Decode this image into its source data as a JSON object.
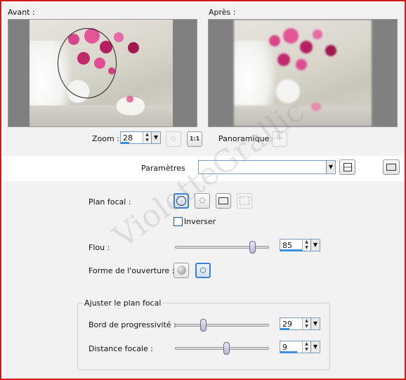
{
  "before_label": "Avant :",
  "after_label": "Après :",
  "zoom": {
    "label": "Zoom :",
    "value": "28",
    "fraction": 0.28
  },
  "pan_label": "Panoramique :",
  "one_to_one": "1:1",
  "parameters": {
    "label": "Paramètres",
    "value": ""
  },
  "focal_plane_label": "Plan focal :",
  "invert_label": "Inverser",
  "blur": {
    "label": "Flou :",
    "value": "85",
    "fraction": 0.85
  },
  "aperture_label": "Forme de l'ouverture :",
  "adjust_group_label": "Ajuster le plan focal",
  "feather": {
    "label": "Bord de progressivité :",
    "value": "29",
    "fraction": 0.29
  },
  "focal_distance": {
    "label": "Distance focale :",
    "value": "9",
    "fraction": 0.55
  },
  "watermark": "VioletteGrallic",
  "colors": {
    "frame": "#d21a1a",
    "accent": "#3b8fe0",
    "panel": "#f2f2f2",
    "flower": "#d0307a"
  }
}
